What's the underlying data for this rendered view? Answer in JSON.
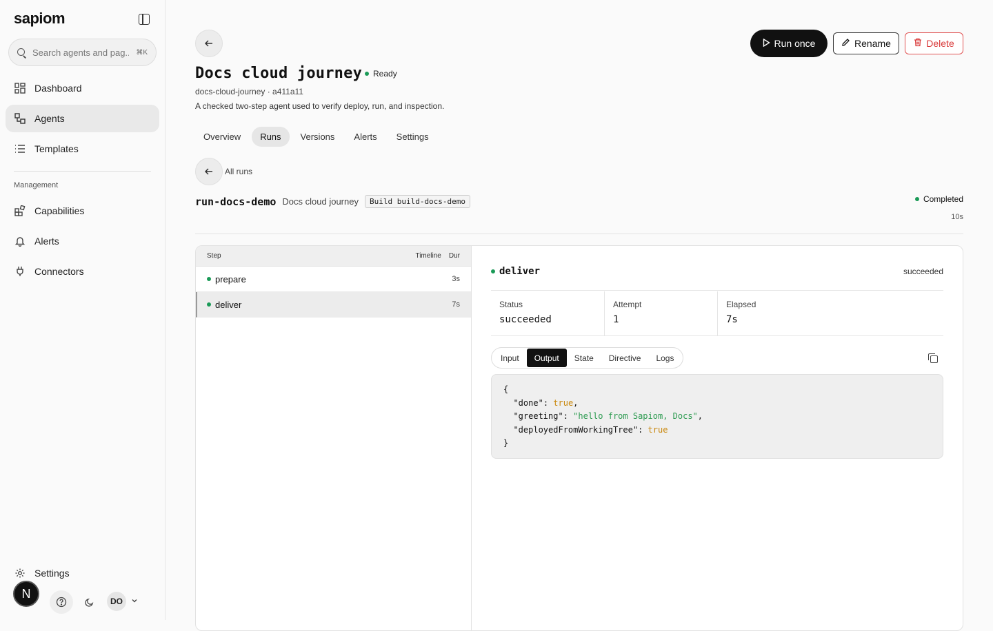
{
  "app": {
    "brand": "sapiom"
  },
  "search": {
    "placeholder": "Search agents and pag...",
    "shortcut": "⌘K"
  },
  "sidebar": {
    "items": [
      {
        "label": "Dashboard",
        "icon": "dashboard-icon"
      },
      {
        "label": "Agents",
        "icon": "agents-icon",
        "active": true
      },
      {
        "label": "Templates",
        "icon": "list-icon"
      }
    ],
    "section_label": "Management",
    "management_items": [
      {
        "label": "Capabilities",
        "icon": "capabilities-icon"
      },
      {
        "label": "Alerts",
        "icon": "bell-icon"
      },
      {
        "label": "Connectors",
        "icon": "plug-icon"
      }
    ],
    "settings_label": "Settings",
    "avatar_letter": "N",
    "user_initials": "DO"
  },
  "agent": {
    "title": "Docs cloud journey",
    "status": "Ready",
    "slug": "docs-cloud-journey · a411a11",
    "description": "A checked two-step agent used to verify deploy, run, and inspection."
  },
  "actions": {
    "run": "Run once",
    "rename": "Rename",
    "delete": "Delete"
  },
  "tabs": [
    "Overview",
    "Runs",
    "Versions",
    "Alerts",
    "Settings"
  ],
  "active_tab": "Runs",
  "run": {
    "back_label": "All runs",
    "id": "run-docs-demo",
    "agent": "Docs cloud journey",
    "build": "Build build-docs-demo",
    "status": "Completed",
    "duration": "10s"
  },
  "steps_table": {
    "headers": {
      "step": "Step",
      "timeline": "Timeline",
      "dur": "Dur"
    },
    "rows": [
      {
        "name": "prepare",
        "dur": "3s"
      },
      {
        "name": "deliver",
        "dur": "7s",
        "active": true
      }
    ]
  },
  "detail": {
    "name": "deliver",
    "state": "succeeded",
    "stats": [
      {
        "label": "Status",
        "value": "succeeded"
      },
      {
        "label": "Attempt",
        "value": "1"
      },
      {
        "label": "Elapsed",
        "value": "7s"
      }
    ],
    "subtabs": [
      "Input",
      "Output",
      "State",
      "Directive",
      "Logs"
    ],
    "active_subtab": "Output",
    "output": {
      "open": "{",
      "close": "}",
      "lines": [
        {
          "key": "\"done\"",
          "value": "true",
          "type": "bool",
          "comma": true
        },
        {
          "key": "\"greeting\"",
          "value": "\"hello from Sapiom, Docs\"",
          "type": "string",
          "comma": true
        },
        {
          "key": "\"deployedFromWorkingTree\"",
          "value": "true",
          "type": "bool",
          "comma": false
        }
      ]
    }
  },
  "colors": {
    "success": "#1a9a57",
    "danger": "#d93a3a",
    "bool": "#c9870b",
    "string": "#2c9b50"
  }
}
